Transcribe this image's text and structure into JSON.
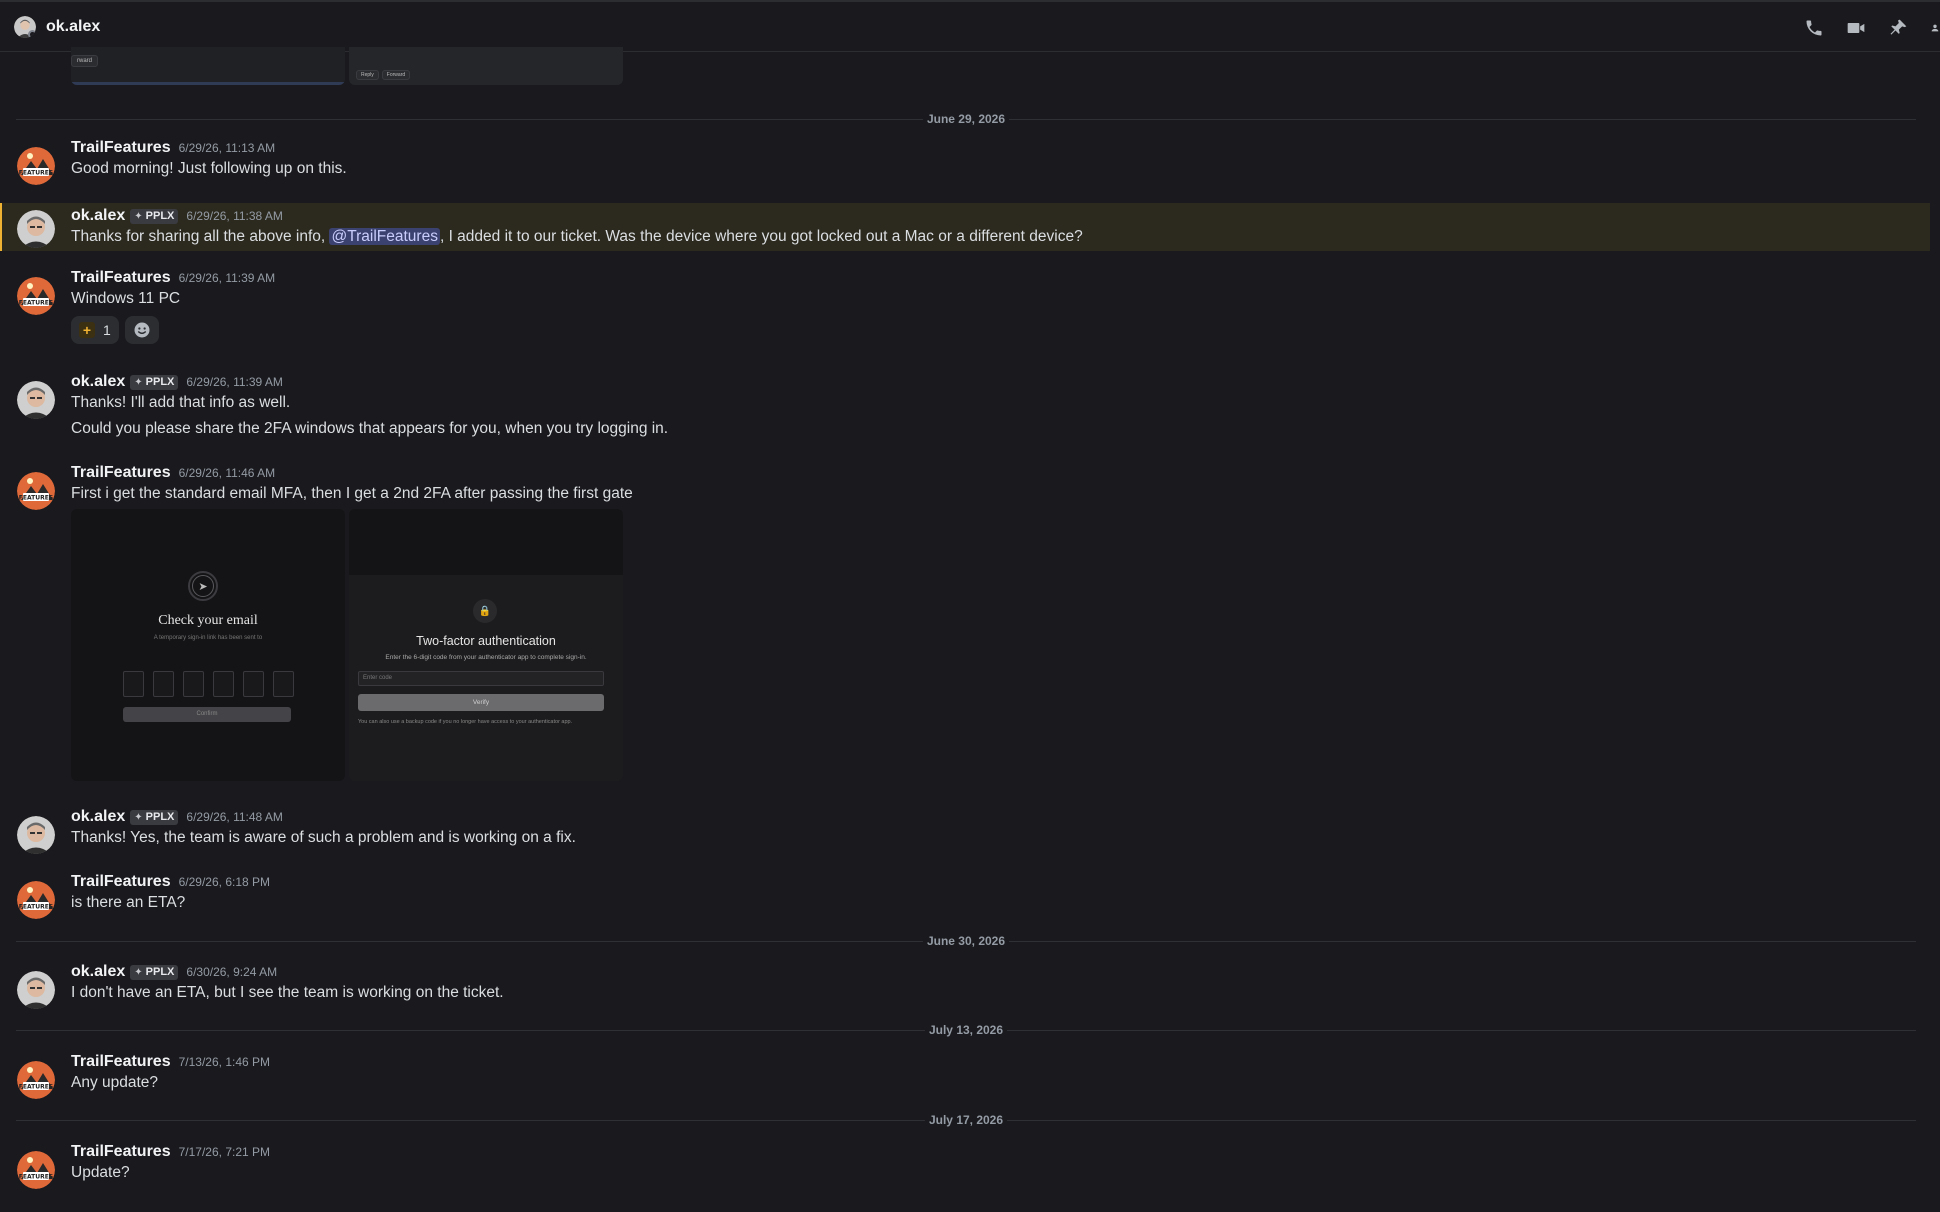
{
  "header": {
    "title": "ok.alex",
    "icons": [
      "phone-icon",
      "video-icon",
      "pin-icon",
      "members-icon"
    ]
  },
  "top_attachments": {
    "left_pill": "rward",
    "right_pills": [
      "Reply",
      "Forward"
    ]
  },
  "dividers": {
    "d1": "June 29, 2026",
    "d2": "June 30, 2026",
    "d3": "July 13, 2026",
    "d4": "July 17, 2026"
  },
  "users": {
    "trail": "TrailFeatures",
    "alex": "ok.alex",
    "alex_tag": "PPLX"
  },
  "messages": {
    "m1": {
      "ts": "6/29/26, 11:13 AM",
      "text": "Good morning! Just following up on this."
    },
    "m2": {
      "ts": "6/29/26, 11:38 AM",
      "text_before": "Thanks for sharing all the above info, ",
      "mention": "@TrailFeatures",
      "text_after": ", I added it to our ticket. Was the device where you got locked out a Mac or a different device?"
    },
    "m3": {
      "ts": "6/29/26, 11:39 AM",
      "text": "Windows 11 PC",
      "reaction_count": "1"
    },
    "m4": {
      "ts": "6/29/26, 11:39 AM",
      "text": "Thanks! I'll add that info as well.",
      "text2": "Could you please share the 2FA windows that appears for you, when you try logging in."
    },
    "m5": {
      "ts": "6/29/26, 11:46 AM",
      "text": "First i get the standard email MFA, then I get a 2nd 2FA after passing the first gate"
    },
    "m6": {
      "ts": "6/29/26, 11:48 AM",
      "text": "Thanks! Yes, the team is aware of such a problem and is working on a fix."
    },
    "m7": {
      "ts": "6/29/26, 6:18 PM",
      "text": "is there an ETA?"
    },
    "m8": {
      "ts": "6/30/26, 9:24 AM",
      "text": "I don't have an ETA, but I see the team is working on the ticket."
    },
    "m9": {
      "ts": "7/13/26, 1:46 PM",
      "text": "Any update?"
    },
    "m10": {
      "ts": "7/17/26, 7:21 PM",
      "text": "Update?"
    }
  },
  "email_mock": {
    "title": "Check your email",
    "subtitle": "A temporary sign-in link has been sent to",
    "button": "Confirm"
  },
  "twofa_mock": {
    "title": "Two-factor authentication",
    "subtitle": "Enter the 6-digit code from your authenticator app to complete sign-in.",
    "placeholder": "Enter code",
    "button": "Verify",
    "footer": "You can also use a backup code if you no longer have access to your authenticator app."
  },
  "colors": {
    "background": "#1a1a1e",
    "highlight_bg": "#2c2a1f",
    "highlight_border": "#f0b232",
    "mention_bg": "#3c4270"
  }
}
